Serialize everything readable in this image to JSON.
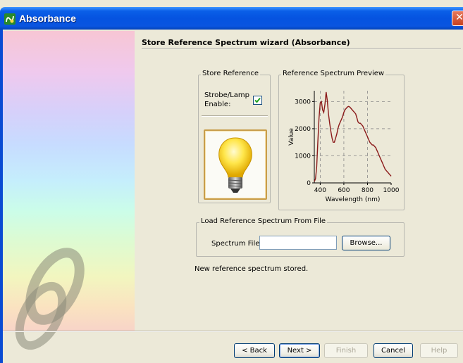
{
  "window": {
    "title": "Absorbance",
    "close_glyph": "✕",
    "app_icon": "oceanview-app-icon"
  },
  "wizard": {
    "title": "Store Reference Spectrum wizard (Absorbance)"
  },
  "store_reference": {
    "legend": "Store Reference",
    "strobe_label": "Strobe/Lamp Enable:",
    "strobe_checked": true,
    "lamp_icon": "light-bulb-icon"
  },
  "preview": {
    "legend": "Reference Spectrum Preview"
  },
  "chart_data": {
    "type": "line",
    "title": "",
    "xlabel": "Wavelength (nm)",
    "ylabel": "Value",
    "xlim": [
      350,
      1000
    ],
    "ylim": [
      0,
      3400
    ],
    "xticks": [
      400,
      600,
      800,
      1000
    ],
    "yticks": [
      0,
      1000,
      2000,
      3000
    ],
    "grid": true,
    "series": [
      {
        "color": "#8b1a1a",
        "x": [
          350,
          360,
          370,
          380,
          390,
          400,
          410,
          420,
          430,
          440,
          450,
          460,
          470,
          480,
          490,
          500,
          510,
          520,
          530,
          540,
          550,
          560,
          570,
          580,
          590,
          600,
          610,
          620,
          630,
          640,
          650,
          660,
          670,
          680,
          690,
          700,
          710,
          720,
          730,
          740,
          750,
          760,
          770,
          780,
          790,
          800,
          810,
          820,
          830,
          840,
          850,
          860,
          870,
          880,
          890,
          900,
          910,
          920,
          930,
          940,
          950,
          960,
          970,
          980,
          990,
          1000
        ],
        "y": [
          50,
          150,
          600,
          1500,
          2400,
          2950,
          3000,
          2700,
          2600,
          2900,
          3350,
          3050,
          2550,
          2200,
          1900,
          1650,
          1500,
          1500,
          1650,
          1800,
          2000,
          2150,
          2250,
          2350,
          2450,
          2600,
          2700,
          2750,
          2800,
          2820,
          2800,
          2750,
          2700,
          2650,
          2600,
          2550,
          2400,
          2250,
          2200,
          2200,
          2150,
          2100,
          2000,
          1900,
          1800,
          1700,
          1600,
          1500,
          1450,
          1400,
          1400,
          1350,
          1300,
          1200,
          1100,
          1000,
          900,
          800,
          700,
          600,
          500,
          450,
          400,
          350,
          300,
          250
        ]
      }
    ]
  },
  "load_reference": {
    "legend": "Load Reference Spectrum From File",
    "spectrum_label": "Spectrum File:",
    "spectrum_value": "",
    "browse_label": "Browse..."
  },
  "status_text": "New reference spectrum stored.",
  "buttons": {
    "back": "< Back",
    "next": "Next >",
    "finish": "Finish",
    "cancel": "Cancel",
    "help": "Help"
  }
}
